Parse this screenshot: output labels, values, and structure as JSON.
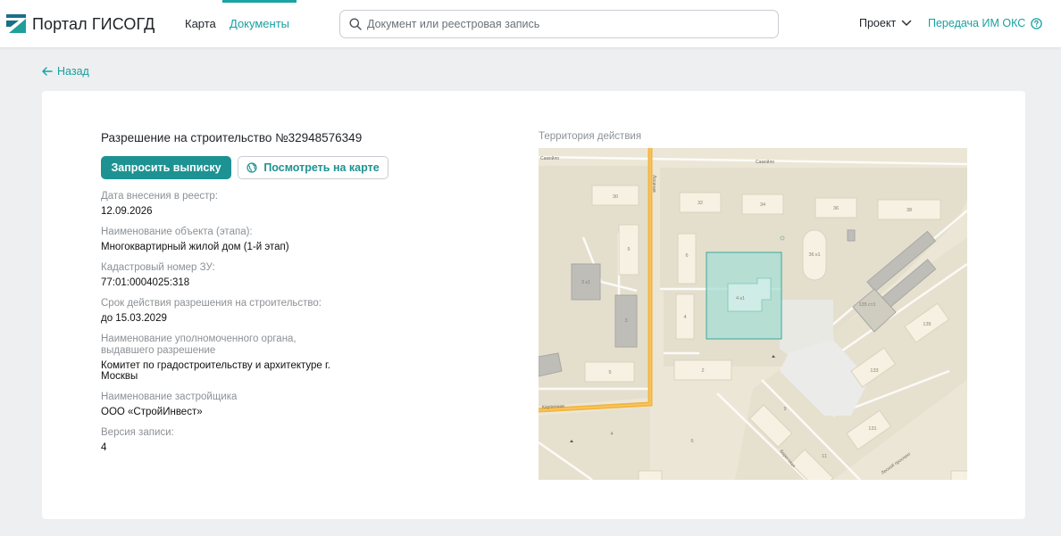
{
  "header": {
    "brand": "Портал ГИСОГД",
    "nav": [
      {
        "label": "Карта",
        "active": false
      },
      {
        "label": "Документы",
        "active": true
      }
    ],
    "search_placeholder": "Документ или реестровая запись",
    "project_label": "Проект",
    "transfer_label": "Передача ИМ ОКС",
    "accent_color": "#1aa3a3"
  },
  "back_label": "Назад",
  "document": {
    "title": "Разрешение на строительство №32948576349",
    "primary_button": "Запросить выписку",
    "secondary_button": "Посмотреть на карте",
    "fields": [
      {
        "label": "Дата внесения в реестр:",
        "value": "12.09.2026"
      },
      {
        "label": "Наименование объекта (этапа):",
        "value": "Многоквартирный жилой дом (1-й этап)"
      },
      {
        "label": "Кадастровый номер ЗУ:",
        "value": "77:01:0004025:318"
      },
      {
        "label": "Срок действия разрешения на строительство:",
        "value": "до 15.03.2029"
      },
      {
        "label": "Наименование уполномоченного органа, выдавшего разрешение",
        "value": "Комитет по градостроительству и архитектуре г. Москвы"
      },
      {
        "label": "Наименование застройщика",
        "value": "ООО «СтройИнвест»"
      },
      {
        "label": "Версия записи:",
        "value": "4"
      }
    ]
  },
  "map": {
    "title": "Территория действия",
    "labels": {
      "b30": "30",
      "b32": "32",
      "b34": "34",
      "b36": "36",
      "b38": "38",
      "b5a": "5",
      "b6": "6",
      "b36k1": "36 к1",
      "b3k1": "3 к1",
      "b3": "3",
      "b4": "4",
      "b4k1": "4 к1",
      "b5b": "5",
      "b2": "2",
      "b135k1": "135 ст1",
      "b135": "135",
      "b133": "133",
      "b131": "131",
      "b9": "9",
      "b11": "11",
      "a4": "4",
      "a6": "6",
      "street_top_left": "Самойло",
      "street_top": "Самойло",
      "street_bottom": "Кирпичная",
      "street_vertical": "Лосиная",
      "street_diag1": "Береговая",
      "street_diag2": "Лесной проспект"
    },
    "colors": {
      "land": "#ece6d6",
      "block": "#e2dccb",
      "building": "#f6f1e2",
      "road_main": "#f2b43b",
      "highlight": "#a7ddd3"
    }
  }
}
